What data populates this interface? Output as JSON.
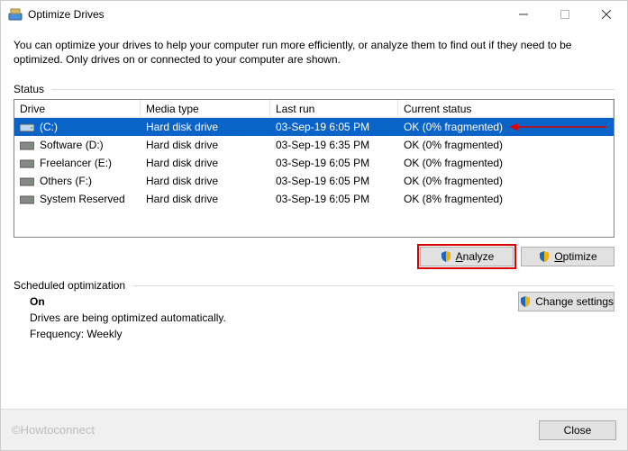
{
  "window": {
    "title": "Optimize Drives"
  },
  "description": "You can optimize your drives to help your computer run more efficiently, or analyze them to find out if they need to be optimized. Only drives on or connected to your computer are shown.",
  "status_section_label": "Status",
  "columns": {
    "drive": "Drive",
    "media": "Media type",
    "last": "Last run",
    "status": "Current status"
  },
  "drives": [
    {
      "name": "(C:)",
      "media": "Hard disk drive",
      "last": "03-Sep-19 6:05 PM",
      "status": "OK (0% fragmented)",
      "selected": true
    },
    {
      "name": "Software (D:)",
      "media": "Hard disk drive",
      "last": "03-Sep-19 6:35 PM",
      "status": "OK (0% fragmented)",
      "selected": false
    },
    {
      "name": "Freelancer (E:)",
      "media": "Hard disk drive",
      "last": "03-Sep-19 6:05 PM",
      "status": "OK (0% fragmented)",
      "selected": false
    },
    {
      "name": "Others (F:)",
      "media": "Hard disk drive",
      "last": "03-Sep-19 6:05 PM",
      "status": "OK (0% fragmented)",
      "selected": false
    },
    {
      "name": "System Reserved",
      "media": "Hard disk drive",
      "last": "03-Sep-19 6:05 PM",
      "status": "OK (8% fragmented)",
      "selected": false
    }
  ],
  "buttons": {
    "analyze": "Analyze",
    "optimize": "Optimize",
    "change": "Change settings",
    "close": "Close"
  },
  "scheduled": {
    "section_label": "Scheduled optimization",
    "state": "On",
    "desc": "Drives are being optimized automatically.",
    "freq_label": "Frequency:",
    "freq_value": "Weekly"
  },
  "watermark": "©Howtoconnect"
}
